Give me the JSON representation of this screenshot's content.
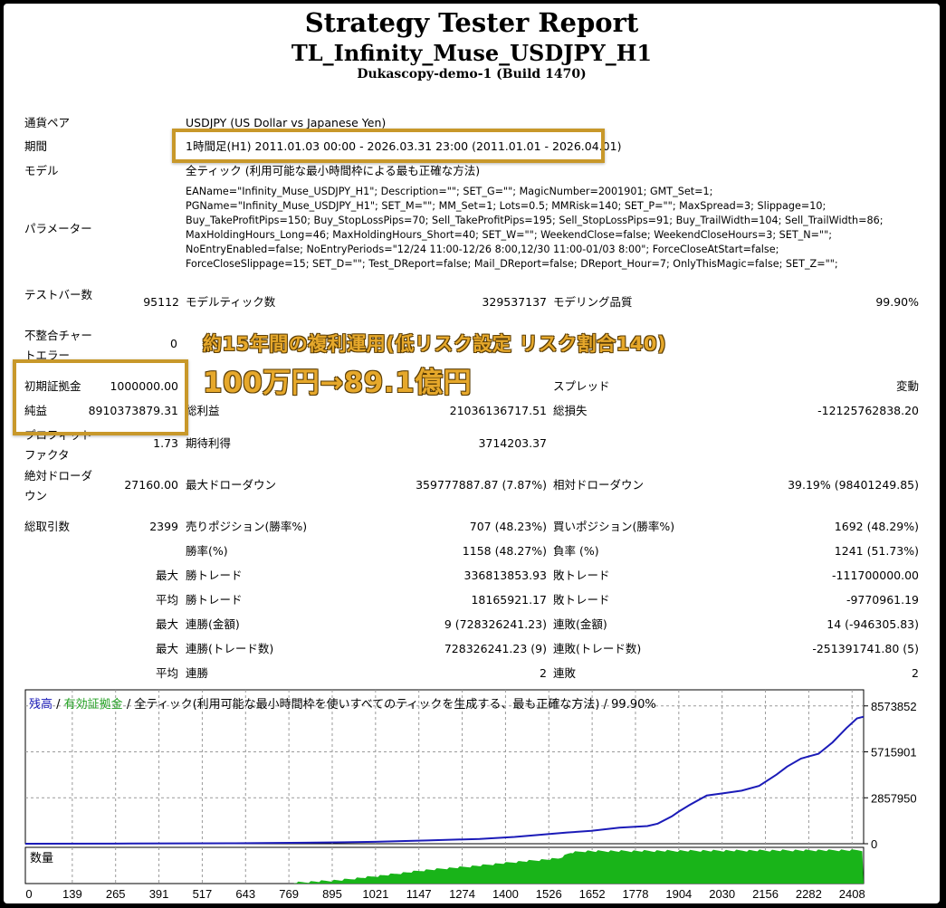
{
  "header": {
    "title": "Strategy Tester Report",
    "ea_symbol": "TL_Infinity_Muse_USDJPY_H1",
    "server": "Dukascopy-demo-1 (Build 1470)"
  },
  "info": {
    "pair_label": "通貨ペア",
    "pair_value": "USDJPY (US Dollar vs Japanese Yen)",
    "period_label": "期間",
    "period_value": "1時間足(H1) 2011.01.03 00:00 - 2026.03.31 23:00 (2011.01.01 - 2026.04.01)",
    "model_label": "モデル",
    "model_value": "全ティック (利用可能な最小時間枠による最も正確な方法)",
    "params_label": "パラメーター",
    "params_value": "EAName=\"Infinity_Muse_USDJPY_H1\"; Description=\"\"; SET_G=\"\"; MagicNumber=2001901; GMT_Set=1;\nPGName=\"Infinity_Muse_USDJPY_H1\"; SET_M=\"\"; MM_Set=1; Lots=0.5; MMRisk=140; SET_P=\"\"; MaxSpread=3; Slippage=10;\nBuy_TakeProfitPips=150; Buy_StopLossPips=70; Sell_TakeProfitPips=195; Sell_StopLossPips=91; Buy_TrailWidth=104; Sell_TrailWidth=86;\nMaxHoldingHours_Long=46; MaxHoldingHours_Short=40; SET_W=\"\"; WeekendClose=false; WeekendCloseHours=3; SET_N=\"\";\nNoEntryEnabled=false; NoEntryPeriods=\"12/24 11:00-12/26 8:00,12/30 11:00-01/03 8:00\"; ForceCloseAtStart=false;\nForceCloseSlippage=15; SET_D=\"\"; Test_DReport=false; Mail_DReport=false; DReport_Hour=7; OnlyThisMagic=false; SET_Z=\"\";"
  },
  "stats": {
    "bars_label": "テストバー数",
    "bars_value": "95112",
    "ticks_label": "モデルティック数",
    "ticks_value": "329537137",
    "quality_label": "モデリング品質",
    "quality_value": "99.90%",
    "mismatch_label": "不整合チャートエラー",
    "mismatch_value": "0",
    "deposit_label": "初期証拠金",
    "deposit_value": "1000000.00",
    "spread_label": "スプレッド",
    "spread_value": "変動",
    "net_label": "純益",
    "net_value": "8910373879.31",
    "gross_profit_label": "総利益",
    "gross_profit_value": "21036136717.51",
    "gross_loss_label": "総損失",
    "gross_loss_value": "-12125762838.20",
    "pf_label": "プロフィットファクタ",
    "pf_value": "1.73",
    "payoff_label": "期待利得",
    "payoff_value": "3714203.37",
    "abs_dd_label": "絶対ドローダウン",
    "abs_dd_value": "27160.00",
    "max_dd_label": "最大ドローダウン",
    "max_dd_value": "359777887.87 (7.87%)",
    "rel_dd_label": "相対ドローダウン",
    "rel_dd_value": "39.19% (98401249.85)",
    "trades_label": "総取引数",
    "trades_value": "2399",
    "short_label": "売りポジション(勝率%)",
    "short_value": "707 (48.23%)",
    "long_label": "買いポジション(勝率%)",
    "long_value": "1692 (48.29%)",
    "winrate_label": "勝率(%)",
    "winrate_value": "1158 (48.27%)",
    "lossrate_label": "負率 (%)",
    "lossrate_value": "1241 (51.73%)",
    "max_label": "最大",
    "avg_label": "平均",
    "win_trade_label": "勝トレード",
    "loss_trade_label": "敗トレード",
    "largest_win_value": "336813853.93",
    "largest_loss_value": "-111700000.00",
    "avg_win_value": "18165921.17",
    "avg_loss_value": "-9770961.19",
    "consec_win_amt_label": "連勝(金額)",
    "consec_win_amt_value": "9 (728326241.23)",
    "consec_loss_amt_label": "連敗(金額)",
    "consec_loss_amt_value": "14 (-946305.83)",
    "consec_win_cnt_label": "連勝(トレード数)",
    "consec_win_cnt_value": "728326241.23 (9)",
    "consec_loss_cnt_label": "連敗(トレード数)",
    "consec_loss_cnt_value": "-251391741.80 (5)",
    "avg_consec_win_label": "連勝",
    "avg_consec_win_value": "2",
    "avg_consec_loss_label": "連敗",
    "avg_consec_loss_value": "2"
  },
  "annotations": {
    "banner_line1": "約15年間の複利運用(低リスク設定 リスク割合140)",
    "banner_line2": "100万円→89.1億円"
  },
  "chart_data": {
    "type": "line",
    "legend": {
      "balance": "残高",
      "sep1": " / ",
      "equity": "有効証拠金",
      "sep2": " / ",
      "rest": "全ティック(利用可能な最小時間枠を使いすべてのティックを生成する、最も正確な方法) / 99.90%"
    },
    "volume_label": "数量",
    "y_ticks": [
      "8573852",
      "5715901",
      "2857950",
      "0"
    ],
    "y_tick_values": [
      8573852,
      5715901,
      2857950,
      0
    ],
    "x_ticks": [
      "0",
      "139",
      "265",
      "391",
      "517",
      "643",
      "769",
      "895",
      "1021",
      "1147",
      "1274",
      "1400",
      "1526",
      "1652",
      "1778",
      "1904",
      "2030",
      "2156",
      "2282",
      "2408"
    ],
    "x_range": [
      0,
      2399
    ],
    "y_range": [
      0,
      9573852
    ],
    "balance_points": [
      [
        0,
        0
      ],
      [
        300,
        10000
      ],
      [
        600,
        30000
      ],
      [
        800,
        60000
      ],
      [
        1000,
        120000
      ],
      [
        1150,
        200000
      ],
      [
        1300,
        300000
      ],
      [
        1400,
        420000
      ],
      [
        1500,
        600000
      ],
      [
        1550,
        700000
      ],
      [
        1620,
        800000
      ],
      [
        1700,
        1000000
      ],
      [
        1780,
        1100000
      ],
      [
        1810,
        1250000
      ],
      [
        1850,
        1700000
      ],
      [
        1870,
        2000000
      ],
      [
        1900,
        2400000
      ],
      [
        1950,
        3000000
      ],
      [
        2000,
        3150000
      ],
      [
        2050,
        3300000
      ],
      [
        2100,
        3600000
      ],
      [
        2150,
        4300000
      ],
      [
        2180,
        4800000
      ],
      [
        2220,
        5300000
      ],
      [
        2270,
        5600000
      ],
      [
        2310,
        6300000
      ],
      [
        2350,
        7200000
      ],
      [
        2380,
        7800000
      ],
      [
        2399,
        7900000
      ]
    ],
    "volume_start": 769,
    "volume_ramp": [
      [
        769,
        0.05
      ],
      [
        900,
        0.12
      ],
      [
        1021,
        0.25
      ],
      [
        1147,
        0.4
      ],
      [
        1274,
        0.5
      ],
      [
        1400,
        0.62
      ],
      [
        1526,
        0.72
      ],
      [
        1560,
        0.88
      ],
      [
        1600,
        0.92
      ],
      [
        2399,
        0.95
      ]
    ],
    "colors": {
      "balance": "#1b1bb8",
      "equity": "#22a022",
      "volume": "#19b419",
      "grid": "#9a9a9a"
    }
  }
}
